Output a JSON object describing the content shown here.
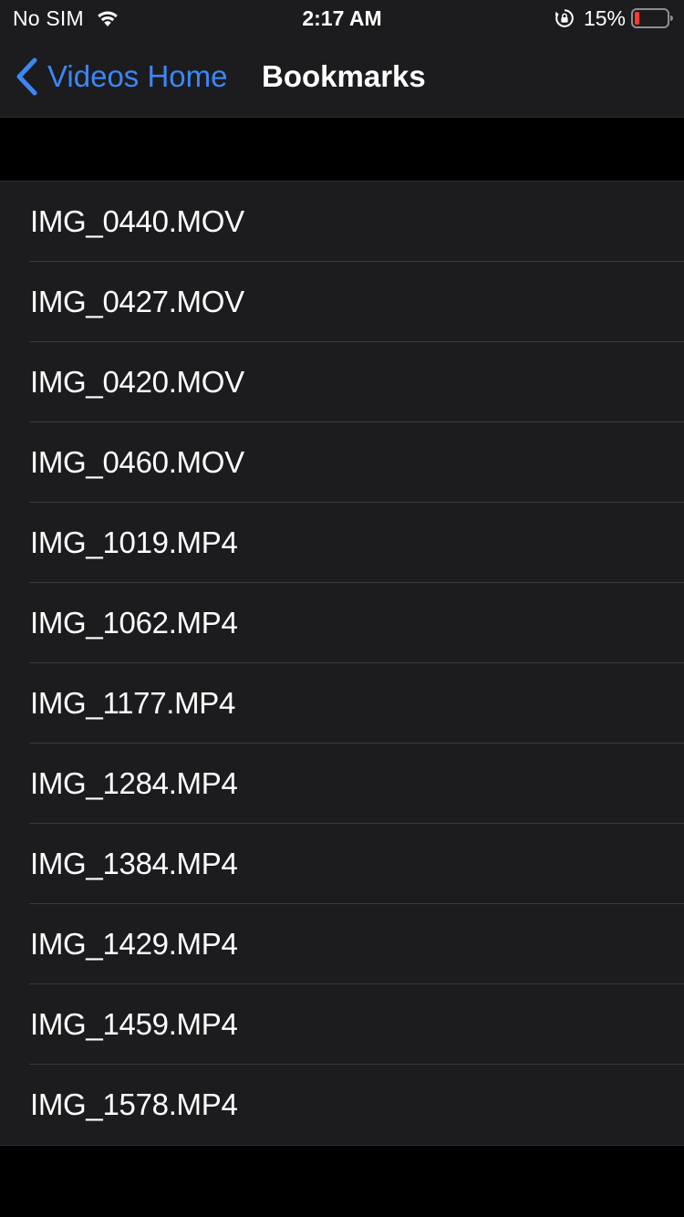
{
  "status_bar": {
    "carrier": "No SIM",
    "time": "2:17 AM",
    "battery_percent": "15%",
    "battery_level": 0.15,
    "battery_color": "#ff3b30",
    "icons": [
      "wifi-icon",
      "orientation-lock-icon",
      "battery-icon"
    ]
  },
  "nav": {
    "back_label": "Videos Home",
    "back_icon": "chevron-left-icon",
    "title": "Bookmarks",
    "accent_color": "#3d86f7"
  },
  "bookmarks": [
    "IMG_0440.MOV",
    "IMG_0427.MOV",
    "IMG_0420.MOV",
    "IMG_0460.MOV",
    "IMG_1019.MP4",
    "IMG_1062.MP4",
    "IMG_1177.MP4",
    "IMG_1284.MP4",
    "IMG_1384.MP4",
    "IMG_1429.MP4",
    "IMG_1459.MP4",
    "IMG_1578.MP4"
  ]
}
